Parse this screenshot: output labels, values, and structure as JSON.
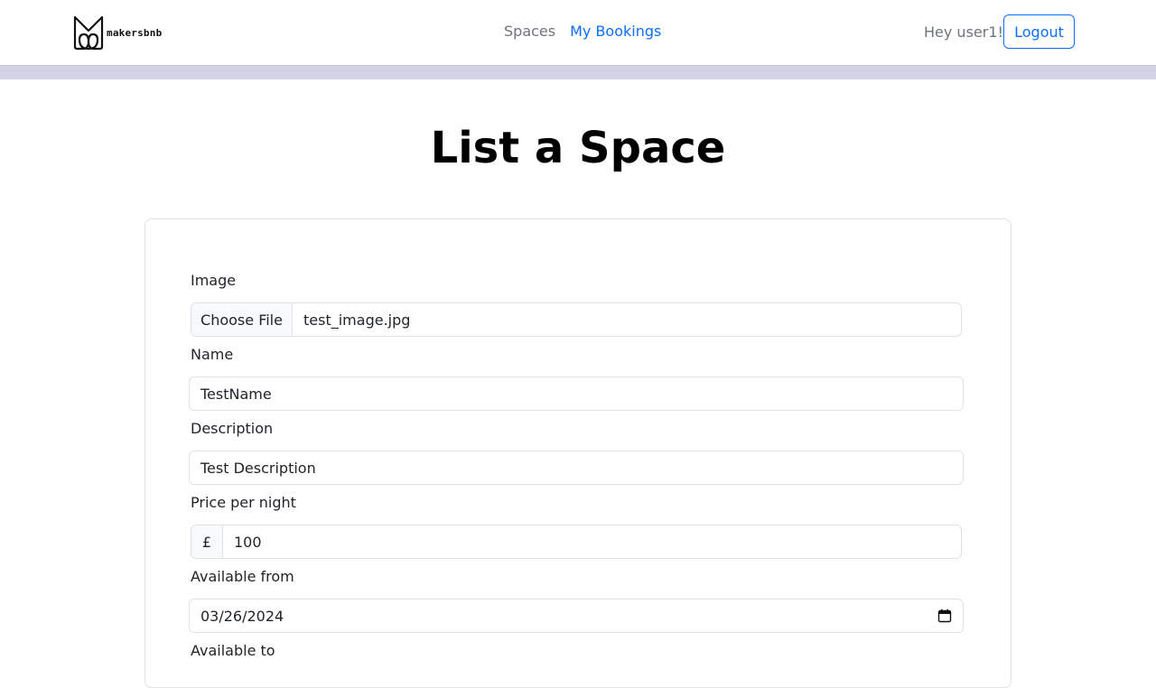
{
  "brand": {
    "name": "makersbnb"
  },
  "nav": {
    "spaces": "Spaces",
    "bookings": "My Bookings"
  },
  "user": {
    "greeting": "Hey user1!",
    "logout": "Logout"
  },
  "page": {
    "title": "List a Space"
  },
  "form": {
    "image": {
      "label": "Image",
      "button": "Choose File",
      "file": "test_image.jpg"
    },
    "name": {
      "label": "Name",
      "value": "TestName"
    },
    "description": {
      "label": "Description",
      "value": "Test Description"
    },
    "price": {
      "label": "Price per night",
      "currency": "£",
      "value": "100"
    },
    "available_from": {
      "label": "Available from",
      "value": "03/26/2024",
      "icon": "calendar-icon"
    },
    "available_to": {
      "label": "Available to"
    }
  },
  "colors": {
    "accent": "#0d6efd",
    "muted": "#6c757d",
    "nav_shadow": "#d3d3e6"
  }
}
